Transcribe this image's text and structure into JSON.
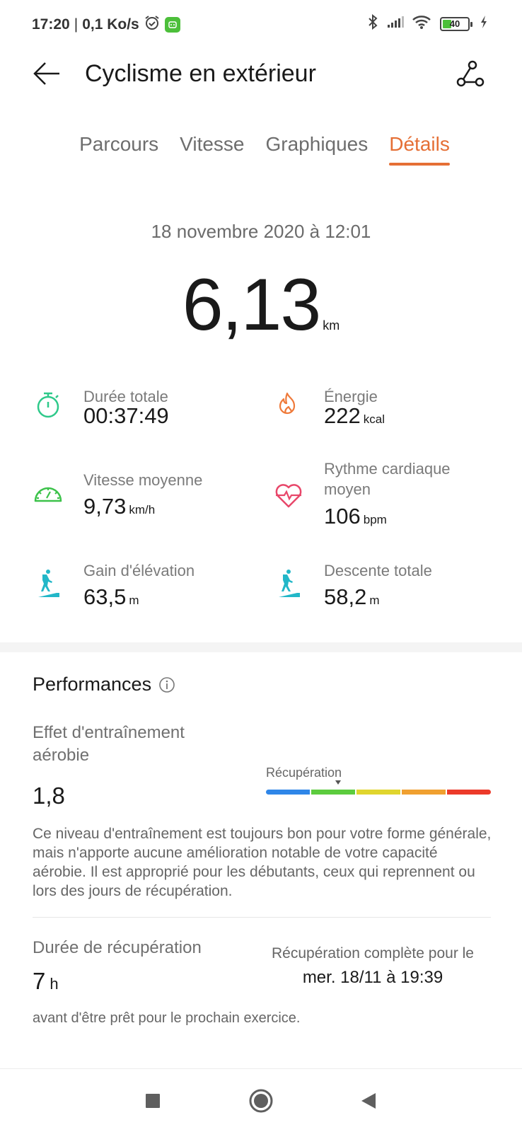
{
  "status_bar": {
    "time": "17:20",
    "separator": "|",
    "network_speed": "0,1 Ko/s",
    "battery_level": "40"
  },
  "header": {
    "title": "Cyclisme en extérieur"
  },
  "tabs": [
    {
      "label": "Parcours",
      "active": false
    },
    {
      "label": "Vitesse",
      "active": false
    },
    {
      "label": "Graphiques",
      "active": false
    },
    {
      "label": "Détails",
      "active": true
    }
  ],
  "summary": {
    "date": "18 novembre 2020 à 12:01",
    "distance": "6,13",
    "distance_unit": "km"
  },
  "metrics": {
    "duration": {
      "label": "Durée totale",
      "value": "00:37:49",
      "unit": ""
    },
    "energy": {
      "label": "Énergie",
      "value": "222",
      "unit": "kcal"
    },
    "avg_speed": {
      "label": "Vitesse moyenne",
      "value": "9,73",
      "unit": "km/h"
    },
    "avg_heart_rate": {
      "label": "Rythme cardiaque moyen",
      "value": "106",
      "unit": "bpm"
    },
    "elevation_gain": {
      "label": "Gain d'élévation",
      "value": "63,5",
      "unit": "m"
    },
    "total_descent": {
      "label": "Descente totale",
      "value": "58,2",
      "unit": "m"
    }
  },
  "performances": {
    "title": "Performances",
    "aerobic_label": "Effet d'entraînement aérobie",
    "aerobic_value": "1,8",
    "scale_label": "Récupération",
    "scale_colors": [
      "#2f86e8",
      "#5ccc3e",
      "#e0d52e",
      "#f0a030",
      "#ec3a2a"
    ],
    "aerobic_description": "Ce niveau d'entraînement est toujours bon pour votre forme générale, mais n'apporte aucune amélioration notable de votre capacité aérobie. Il est approprié pour les débutants, ceux qui reprennent ou lors des jours de récupération.",
    "recovery_label": "Durée de récupération",
    "recovery_value": "7",
    "recovery_unit": "h",
    "recovery_full_label": "Récupération complète pour le",
    "recovery_full_date": "mer. 18/11 à 19:39",
    "recovery_note": "avant d'être prêt pour le prochain exercice."
  },
  "colors": {
    "accent": "#e56f35",
    "duration_icon": "#2ec98a",
    "speed_icon": "#3cc24a",
    "energy_icon": "#ef7a3a",
    "heart_icon": "#e8476a",
    "elevation_icon": "#22b7c8"
  }
}
